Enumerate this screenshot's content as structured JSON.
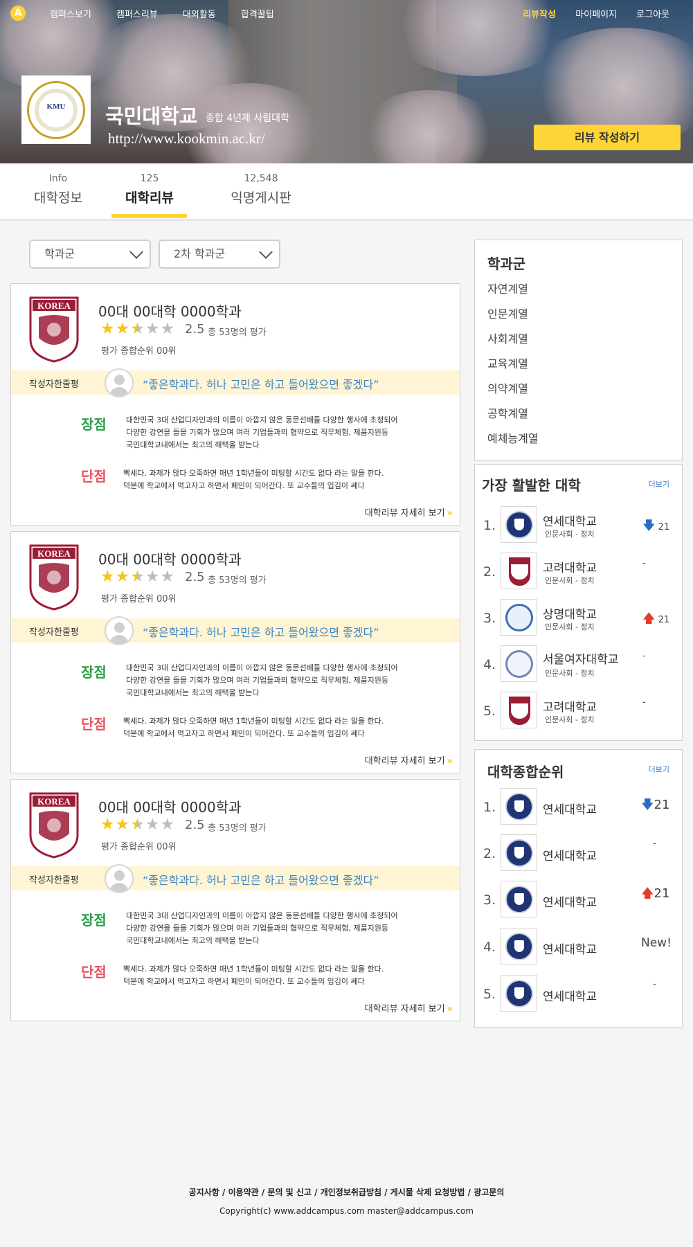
{
  "nav": {
    "logo_letter": "A",
    "left": [
      "캠퍼스보기",
      "캠퍼스리뷰",
      "대외활동",
      "합격꿀팁"
    ],
    "right": [
      "리뷰작성",
      "마이페이지",
      "로그아웃"
    ]
  },
  "university": {
    "logo_text": "KMU",
    "name": "국민대학교",
    "subtitle": "종합 4년제 사립대학",
    "url": "http://www.kookmin.ac.kr/",
    "write_review_label": "리뷰 작성하기"
  },
  "tabs": [
    {
      "count": "Info",
      "label": "대학정보"
    },
    {
      "count": "125",
      "label": "대학리뷰"
    },
    {
      "count": "12,548",
      "label": "익명게시판"
    }
  ],
  "filters": {
    "first": "학과군",
    "second": "2차 학과군"
  },
  "reviews": [
    {
      "dept": "00대 00대학 0000학과",
      "rating": 2.5,
      "score": "2.5",
      "count": "총 53명의 평가",
      "rank": "평가 종합순위 00위",
      "oneline_tag": "작성자한줄평",
      "quote": "“좋은학과다. 허나 고민은 하고 들어왔으면 좋겠다”",
      "pros_title": "장점",
      "pros": [
        "대한민국 3대 산업디자인과의 이름이 아깝지 않은 동문선배들 다양한 행사에 초청되어",
        "다양한 강연을 들을 기회가 많으며 여러 기업들과의 협약으로 직무체험, 제품지원등",
        "국민대학교내에서는 최고의 해택을 받는다"
      ],
      "cons_title": "단점",
      "cons": [
        "빡세다. 과제가 많다 오죽하면 매년 1학년들이 미팅할 시간도 없다 라는 말을 한다.",
        "덕분에 학교에서 먹고자고 하면서 폐인이 되어간다. 또 교수들의 입김이 쎄다"
      ],
      "more": "대학리뷰 자세히 보기"
    },
    {
      "dept": "00대 00대학 0000학과",
      "rating": 2.5,
      "score": "2.5",
      "count": "총 53명의 평가",
      "rank": "평가 종합순위 00위",
      "oneline_tag": "작성자한줄평",
      "quote": "“좋은학과다. 허나 고민은 하고 들어왔으면 좋겠다”",
      "pros_title": "장점",
      "pros": [
        "대한민국 3대 산업디자인과의 이름이 아깝지 않은 동문선배들 다양한 행사에 초청되어",
        "다양한 강연을 들을 기회가 많으며 여러 기업들과의 협약으로 직무체험, 제품지원등",
        "국민대학교내에서는 최고의 해택을 받는다"
      ],
      "cons_title": "단점",
      "cons": [
        "빡세다. 과제가 많다 오죽하면 매년 1학년들이 미팅할 시간도 없다 라는 말을 한다.",
        "덕분에 학교에서 먹고자고 하면서 폐인이 되어간다. 또 교수들의 입김이 쎄다"
      ],
      "more": "대학리뷰 자세히 보기"
    },
    {
      "dept": "00대 00대학 0000학과",
      "rating": 2.5,
      "score": "2.5",
      "count": "총 53명의 평가",
      "rank": "평가 종합순위 00위",
      "oneline_tag": "작성자한줄평",
      "quote": "“좋은학과다. 허나 고민은 하고 들어왔으면 좋겠다”",
      "pros_title": "장점",
      "pros": [
        "대한민국 3대 산업디자인과의 이름이 아깝지 않은 동문선배들 다양한 행사에 초청되어",
        "다양한 강연을 들을 기회가 많으며 여러 기업들과의 협약으로 직무체험, 제품지원등",
        "국민대학교내에서는 최고의 해택을 받는다"
      ],
      "cons_title": "단점",
      "cons": [
        "빡세다. 과제가 많다 오죽하면 매년 1학년들이 미팅할 시간도 없다 라는 말을 한다.",
        "덕분에 학교에서 먹고자고 하면서 폐인이 되어간다. 또 교수들의 입김이 쎄다"
      ],
      "more": "대학리뷰 자세히 보기"
    }
  ],
  "shield_text": "KOREA",
  "categories": {
    "title": "학과군",
    "items": [
      "자연계열",
      "인문계열",
      "사회계열",
      "교육계열",
      "의약계열",
      "공학계열",
      "예체능계열"
    ]
  },
  "active": {
    "title": "가장 활발한 대학",
    "more": "더보기",
    "items": [
      {
        "num": "1.",
        "name": "연세대학교",
        "sub": "인문사회 - 정치",
        "logo": "yonsei",
        "trend": "down",
        "change": "21"
      },
      {
        "num": "2.",
        "name": "고려대학교",
        "sub": "인문사회 - 정치",
        "logo": "korea",
        "trend": "none",
        "change": "-"
      },
      {
        "num": "3.",
        "name": "상명대학교",
        "sub": "인문사회 - 정치",
        "logo": "sangmyung",
        "trend": "up",
        "change": "21"
      },
      {
        "num": "4.",
        "name": "서울여자대학교",
        "sub": "인문사회 - 정치",
        "logo": "swu",
        "trend": "none",
        "change": "-"
      },
      {
        "num": "5.",
        "name": "고려대학교",
        "sub": "인문사회 - 정치",
        "logo": "korea",
        "trend": "none",
        "change": "-"
      }
    ]
  },
  "overall": {
    "title": "대학종합순위",
    "more": "더보기",
    "items": [
      {
        "num": "1.",
        "name": "연세대학교",
        "trend": "down",
        "change": "21"
      },
      {
        "num": "2.",
        "name": "연세대학교",
        "trend": "none",
        "change": "-"
      },
      {
        "num": "3.",
        "name": "연세대학교",
        "trend": "up",
        "change": "21"
      },
      {
        "num": "4.",
        "name": "연세대학교",
        "trend": "new",
        "change": "New!"
      },
      {
        "num": "5.",
        "name": "연세대학교",
        "trend": "none",
        "change": "-"
      }
    ]
  },
  "footer": {
    "links": "공지사항  /  이용약관  /  문의 및 신고  /  개인정보취급방침  /  게시물 삭제 요청방법  /  광고문의",
    "copyright": "Copyright(c) www.addcampus.com    master@addcampus.com"
  },
  "colors": {
    "accent": "#ffd436",
    "pros": "#2a9f46",
    "cons": "#e8525a",
    "quote": "#3b86c6",
    "up": "#e53a2d",
    "down": "#2b6cc4"
  }
}
